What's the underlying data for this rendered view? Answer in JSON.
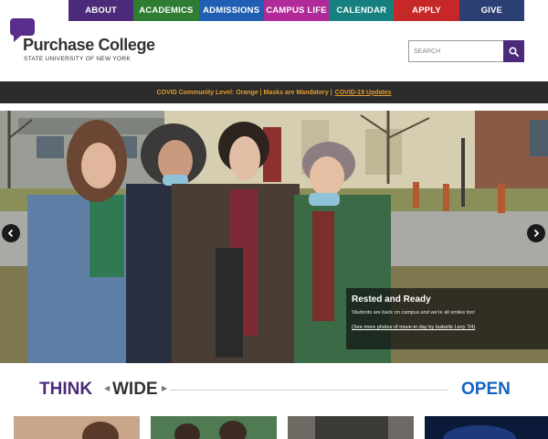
{
  "topnav": {
    "items": [
      {
        "label": "ABOUT",
        "color": "#4b2a7a"
      },
      {
        "label": "ACADEMICS",
        "color": "#2e7d32"
      },
      {
        "label": "ADMISSIONS",
        "color": "#1e5fb4"
      },
      {
        "label": "CAMPUS LIFE",
        "color": "#b02a98"
      },
      {
        "label": "CALENDAR",
        "color": "#15807e"
      },
      {
        "label": "APPLY",
        "color": "#c62828"
      },
      {
        "label": "GIVE",
        "color": "#2b3f73"
      }
    ]
  },
  "logo": {
    "name": "Purchase College",
    "subtitle": "STATE UNIVERSITY OF NEW YORK",
    "color": "#4b2a7a"
  },
  "search": {
    "placeholder": "SEARCH",
    "value": "",
    "button_icon": "search-icon",
    "button_color": "#4b2a7a"
  },
  "alert": {
    "text": "COVID Community Level: Orange | Masks are Mandatory |",
    "link": "COVID-19 Updates",
    "color": "#e49b2b"
  },
  "hero": {
    "prev_icon": "chevron-left-icon",
    "next_icon": "chevron-right-icon",
    "caption": {
      "title": "Rested and Ready",
      "text": "Students are back on campus and we're all smiles too!",
      "link": "(See more photos of move-in day by Isabelle Levy '24)"
    }
  },
  "tagline": {
    "think": "THINK",
    "wide": "WIDE",
    "open": "OPEN",
    "think_color": "#4b2a7a",
    "open_color": "#1565c0"
  },
  "thumbnails": {
    "count_visible": 4
  }
}
